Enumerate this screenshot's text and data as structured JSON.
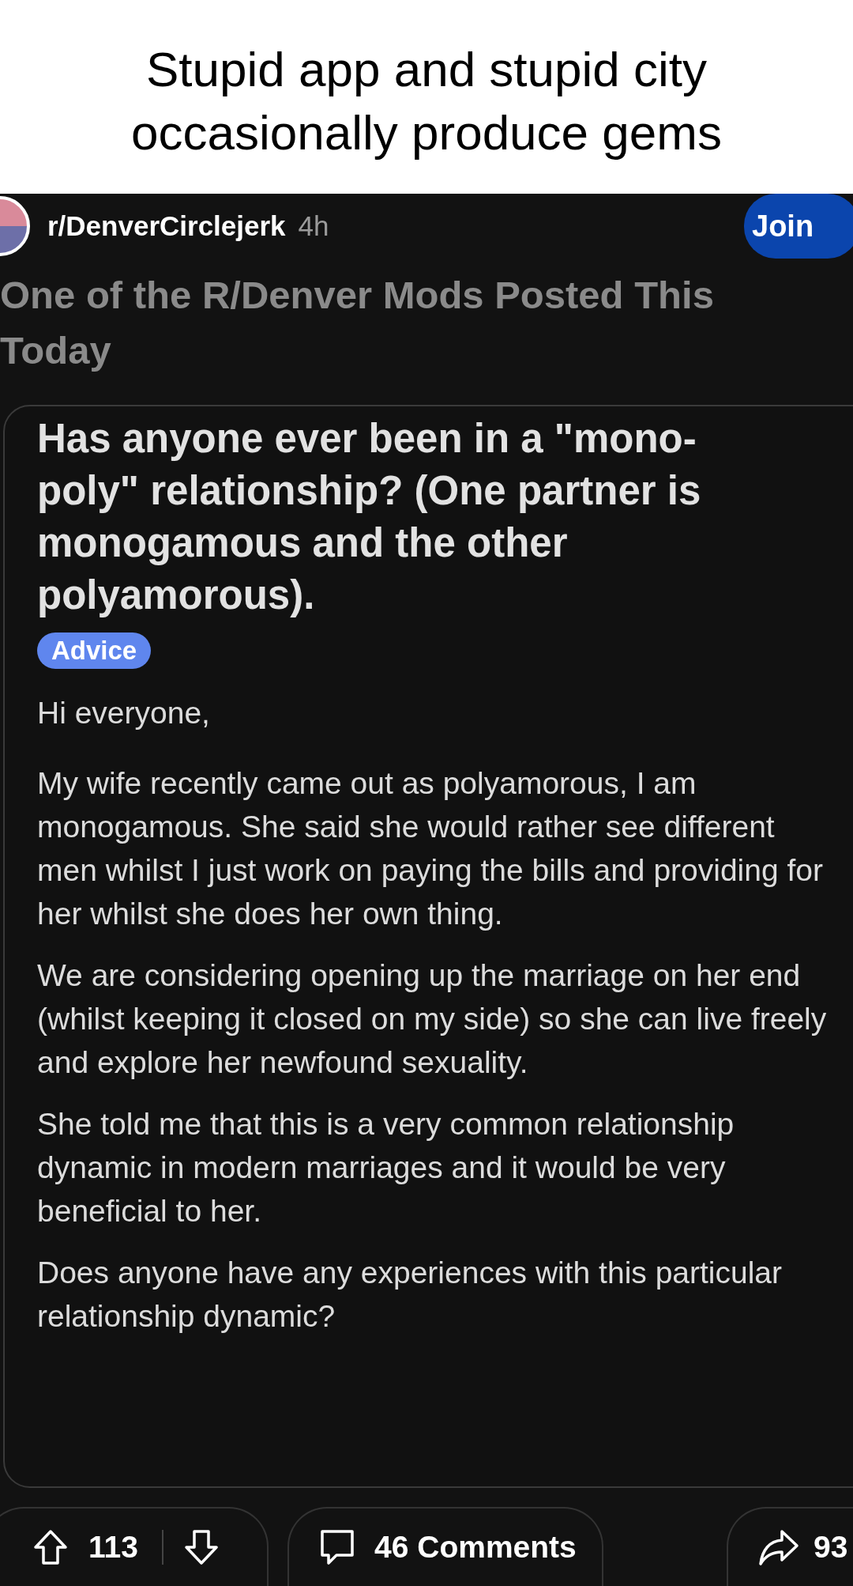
{
  "caption": "Stupid app and stupid city occasionally produce gems",
  "post": {
    "subreddit": "r/DenverCirclejerk",
    "time": "4h",
    "join_button": "Join",
    "title": "One of the R/Denver Mods Posted This Today"
  },
  "embedded_post": {
    "title": "Has anyone ever been in a \"mono-poly\" relationship? (One partner is monogamous and the other polyamorous).",
    "flair": "Advice",
    "paragraphs": [
      "Hi everyone,",
      "My wife recently came out as polyamorous, I am monogamous. She said she would rather see different men whilst I just work on paying the bills and providing for her whilst she does her own thing.",
      "We are considering opening up the marriage on her end (whilst keeping it closed on my side) so she can live freely and explore her newfound sexuality.",
      "She told me that this is a very common relationship dynamic in modern marriages and it would be very beneficial to her.",
      "Does anyone have any experiences with this particular relationship dynamic?"
    ]
  },
  "actions": {
    "upvotes": "113",
    "comments": "46 Comments",
    "shares": "93"
  }
}
